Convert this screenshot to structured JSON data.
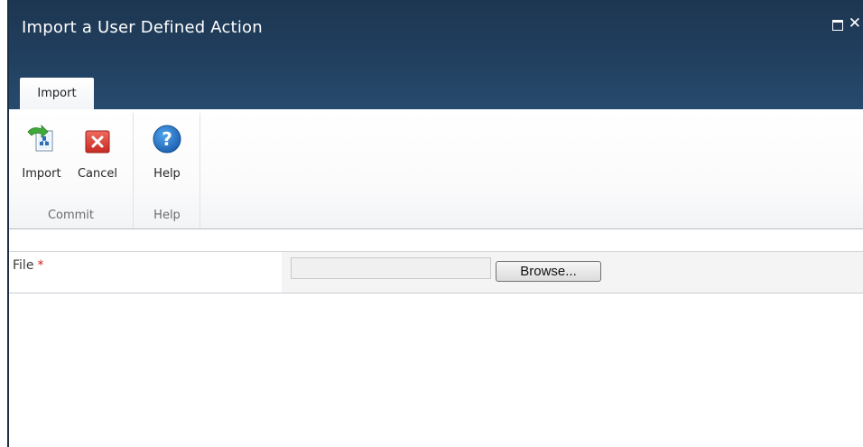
{
  "dialog": {
    "title": "Import a User Defined Action"
  },
  "ribbon": {
    "tabs": [
      {
        "label": "Import",
        "selected": true
      }
    ],
    "groups": [
      {
        "label": "Commit",
        "buttons": [
          {
            "label": "Import",
            "icon": "import-icon"
          },
          {
            "label": "Cancel",
            "icon": "cancel-icon"
          }
        ]
      },
      {
        "label": "Help",
        "buttons": [
          {
            "label": "Help",
            "icon": "help-icon"
          }
        ]
      }
    ]
  },
  "form": {
    "file_label": "File",
    "required_marker": "*",
    "file_value": "",
    "browse_label": "Browse..."
  },
  "colors": {
    "header_bg": "#21405f",
    "ribbon_bg": "#ffffff",
    "required": "#cc2222",
    "help_icon": "#1f6fc2",
    "cancel_icon": "#cc3333"
  }
}
